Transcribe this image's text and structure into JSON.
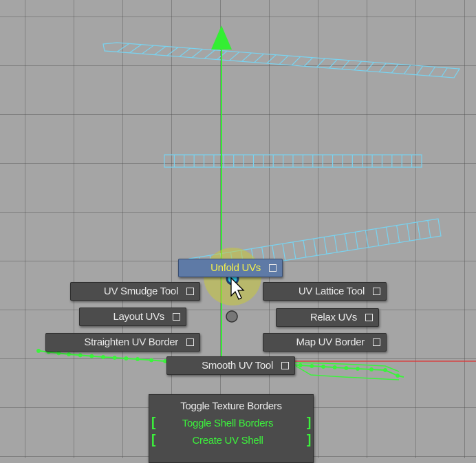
{
  "viewport": {
    "name": "uv-editor-viewport",
    "colors": {
      "background": "#a5a5a5",
      "uv_wireframe": "#79d3f0",
      "selected_edges": "#3cf33c",
      "manipulator": "#33ee33",
      "axis_line": "#e03030"
    }
  },
  "marking_menu": {
    "north": {
      "label": "Unfold UVs",
      "option_icon": "option-box-icon",
      "highlighted": true
    },
    "west": {
      "label": "UV Smudge Tool",
      "option_icon": "option-box-icon"
    },
    "east": {
      "label": "UV Lattice Tool",
      "option_icon": "option-box-icon"
    },
    "west_lower": {
      "label": "Layout UVs",
      "option_icon": "option-box-icon"
    },
    "east_lower": {
      "label": "Relax UVs",
      "option_icon": "option-box-icon"
    },
    "southwest": {
      "label": "Straighten UV Border",
      "option_icon": "option-box-icon"
    },
    "southeast": {
      "label": "Map UV Border",
      "option_icon": "option-box-icon"
    },
    "south": {
      "label": "Smooth UV Tool",
      "option_icon": "option-box-icon"
    },
    "colors": {
      "item_bg": "#4c4c4c",
      "highlight_bg": "#5e7aa6",
      "highlight_text": "#f4f04a",
      "text": "#e9e9e9"
    }
  },
  "overflow_menu": {
    "items": [
      {
        "label": "Toggle Texture Borders",
        "color": "#ebebeb"
      },
      {
        "label": "Toggle Shell Borders",
        "color": "#3cf33c",
        "bracket_left": "[",
        "bracket_right": "]"
      },
      {
        "label": "Create UV Shell",
        "color": "#3cf33c",
        "bracket_left": "[",
        "bracket_right": "]"
      }
    ]
  },
  "cursor": {
    "icon": "arrow-cursor-icon"
  }
}
